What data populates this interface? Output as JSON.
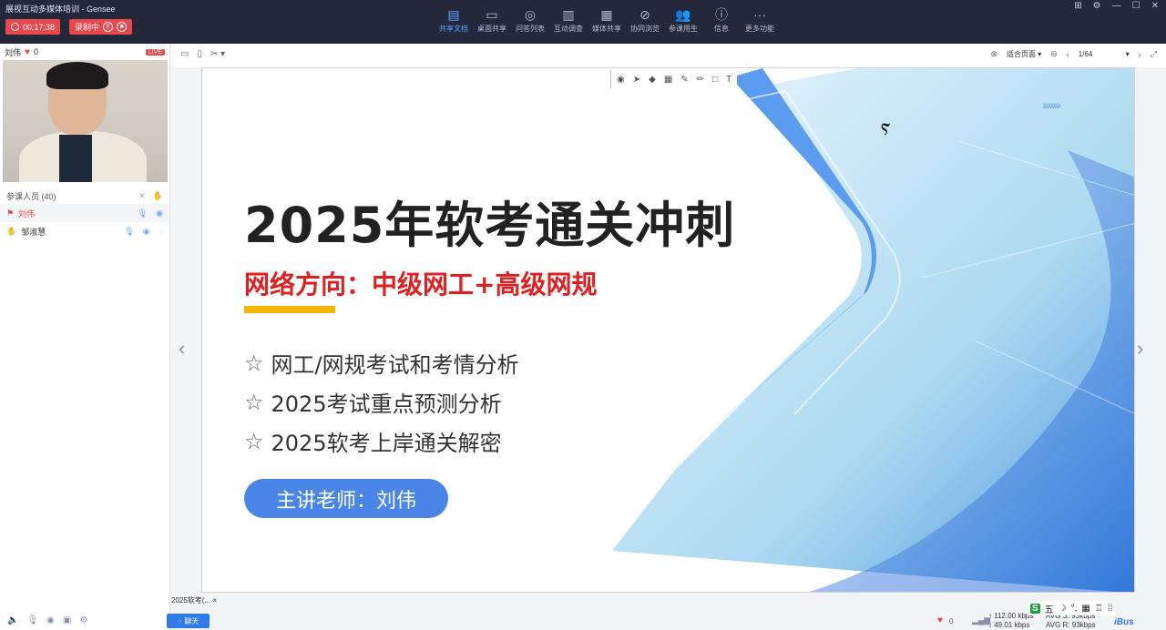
{
  "window": {
    "title": "展视互动多媒体培训 - Gensee",
    "controls": [
      "⊞",
      "⚙",
      "—",
      "☐",
      "✕"
    ]
  },
  "recording": {
    "timer": "00:17:38",
    "status": "录制中"
  },
  "toolbar": {
    "items": [
      {
        "label": "共享文档",
        "icon": "document-icon",
        "glyph": "▤",
        "active": true
      },
      {
        "label": "桌面共享",
        "icon": "desktop-icon",
        "glyph": "▭",
        "active": false
      },
      {
        "label": "问答列表",
        "icon": "qa-icon",
        "glyph": "◎",
        "active": false
      },
      {
        "label": "互动调查",
        "icon": "poll-icon",
        "glyph": "▥",
        "active": false
      },
      {
        "label": "媒体共享",
        "icon": "media-icon",
        "glyph": "▦",
        "active": false
      },
      {
        "label": "协同浏览",
        "icon": "browse-icon",
        "glyph": "⊘",
        "active": false
      },
      {
        "label": "参课用生",
        "icon": "users-icon",
        "glyph": "👥",
        "active": false
      },
      {
        "label": "信息",
        "icon": "info-icon",
        "glyph": "ⓘ",
        "active": false
      },
      {
        "label": "更多功能",
        "icon": "more-icon",
        "glyph": "···",
        "active": false
      }
    ]
  },
  "presenter": {
    "name": "刘伟",
    "likes": "0",
    "live_badge": "LIVE"
  },
  "participants": {
    "header": "参课人员 (40)",
    "list": [
      {
        "name": "刘伟",
        "selected": true
      },
      {
        "name": "邹淑慧",
        "selected": false
      }
    ]
  },
  "viewbar": {
    "fit_mode": "适合页面",
    "page": "1/64"
  },
  "slide": {
    "title": "2025年软考通关冲刺",
    "subtitle": "网络方向：中级网工+高级网规",
    "bullets": [
      "网工/网规考试和考情分析",
      "2025考试重点预测分析",
      "2025软考上岸通关解密"
    ],
    "teacher": "主讲老师：刘伟",
    "chevrons": "›››››››",
    "accent_color": "#4a86e8",
    "subtitle_color": "#e02020",
    "bar_color": "#f5b500"
  },
  "doc_tab": "2025软考(...",
  "chat_button": "聊天",
  "status": {
    "likes": "0",
    "rate_up": "112.00 kbps",
    "rate_down": "49.01 kbps",
    "avg_up": "AVG S: 93kbps",
    "avg_down": "AVG R: 93kbps",
    "ime": "五",
    "brand": "iBus"
  }
}
